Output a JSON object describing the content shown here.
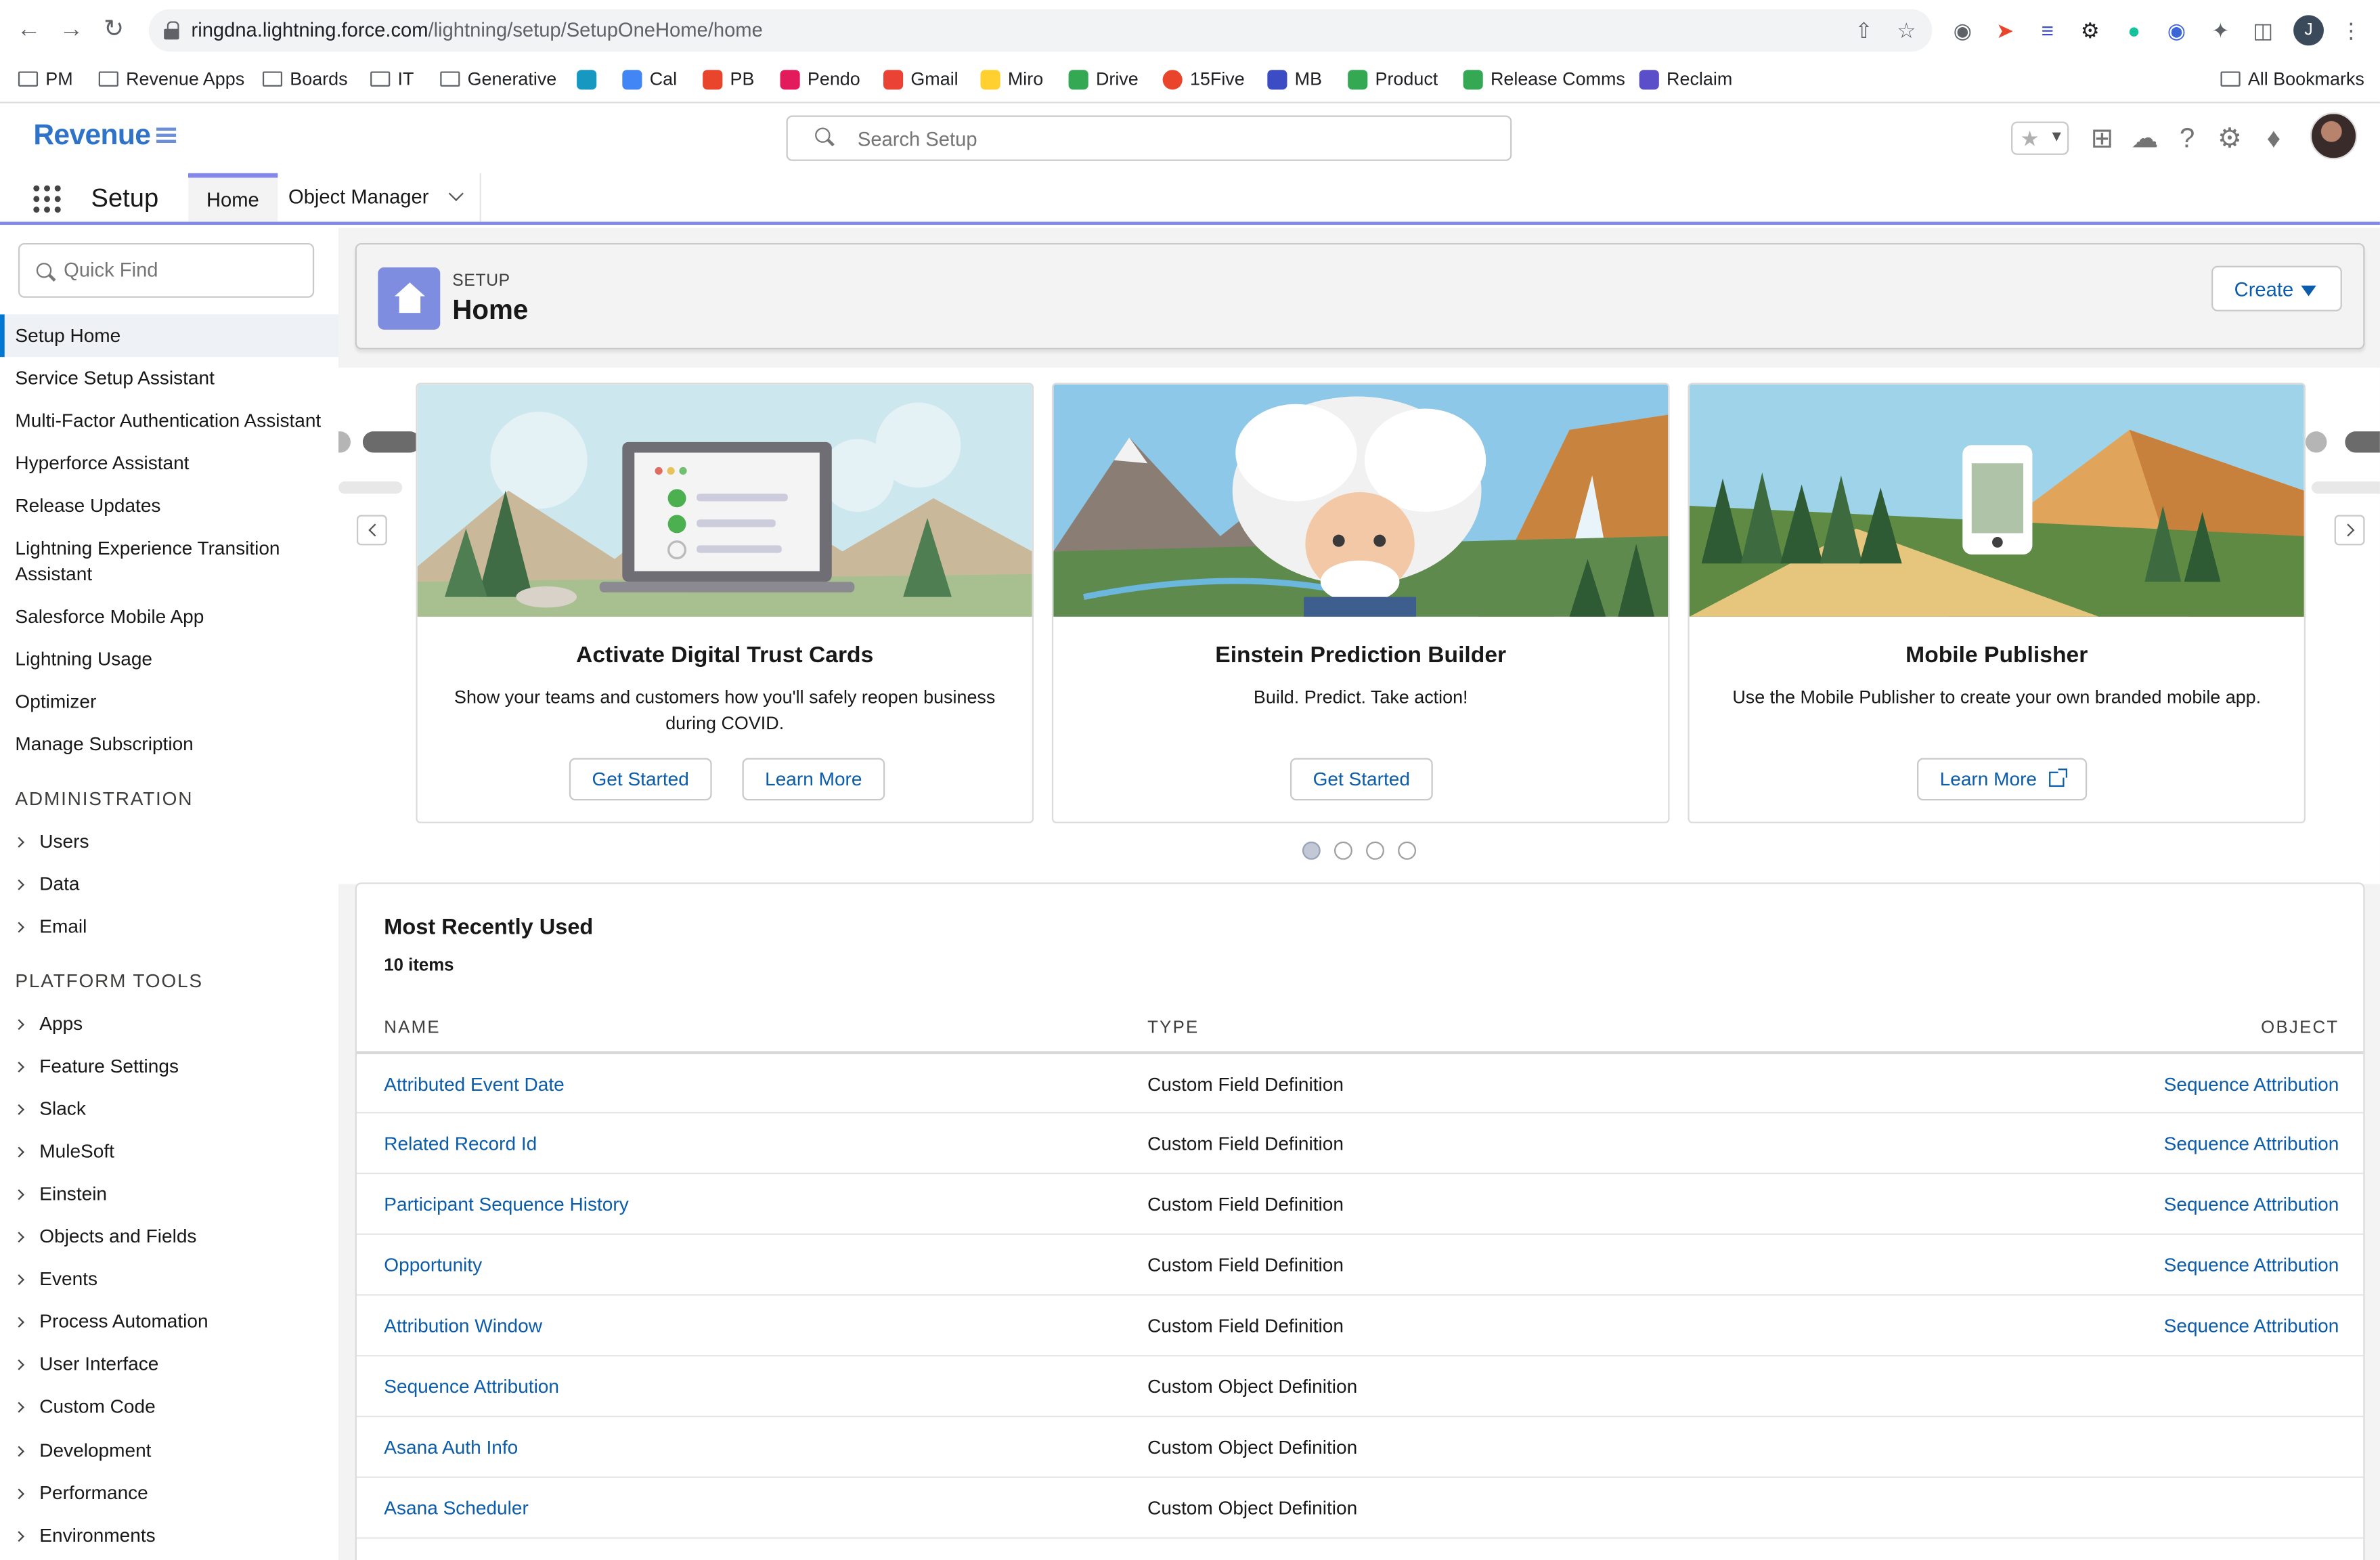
{
  "browser": {
    "url_host": "ringdna.lightning.force.com",
    "url_path": "/lightning/setup/SetupOneHome/home",
    "bookmarks": [
      "PM",
      "Revenue Apps",
      "Boards",
      "IT",
      "Generative",
      "Cal",
      "PB",
      "Pendo",
      "Gmail",
      "Miro",
      "Drive",
      "15Five",
      "MB",
      "Product",
      "Release Comms",
      "Reclaim"
    ],
    "all_bookmarks": "All Bookmarks",
    "profile_initial": "J"
  },
  "header": {
    "brand": "Revenue",
    "search_placeholder": "Search Setup"
  },
  "setup_bar": {
    "title": "Setup",
    "tabs": [
      {
        "label": "Home"
      },
      {
        "label": "Object Manager"
      }
    ]
  },
  "sidebar": {
    "quick_find_placeholder": "Quick Find",
    "items": [
      "Setup Home",
      "Service Setup Assistant",
      "Multi-Factor Authentication Assistant",
      "Hyperforce Assistant",
      "Release Updates",
      "Lightning Experience Transition Assistant",
      "Salesforce Mobile App",
      "Lightning Usage",
      "Optimizer",
      "Manage Subscription"
    ],
    "administration_heading": "ADMINISTRATION",
    "administration": [
      "Users",
      "Data",
      "Email"
    ],
    "platform_heading": "PLATFORM TOOLS",
    "platform": [
      "Apps",
      "Feature Settings",
      "Slack",
      "MuleSoft",
      "Einstein",
      "Objects and Fields",
      "Events",
      "Process Automation",
      "User Interface",
      "Custom Code",
      "Development",
      "Performance",
      "Environments"
    ]
  },
  "page_header": {
    "subtitle": "SETUP",
    "title": "Home",
    "create_label": "Create"
  },
  "carousel": {
    "cards": [
      {
        "title": "Activate Digital Trust Cards",
        "desc": "Show your teams and customers how you'll safely reopen business during COVID.",
        "btn1": "Get Started",
        "btn2": "Learn More"
      },
      {
        "title": "Einstein Prediction Builder",
        "desc": "Build. Predict. Take action!",
        "btn1": "Get Started"
      },
      {
        "title": "Mobile Publisher",
        "desc": "Use the Mobile Publisher to create your own branded mobile app.",
        "btn1": "Learn More"
      }
    ],
    "pages": 4,
    "active_page": 1
  },
  "mru": {
    "title": "Most Recently Used",
    "count": "10 items",
    "columns": {
      "name": "NAME",
      "type": "TYPE",
      "object": "OBJECT"
    },
    "rows": [
      {
        "name": "Attributed Event Date",
        "type": "Custom Field Definition",
        "object": "Sequence Attribution"
      },
      {
        "name": "Related Record Id",
        "type": "Custom Field Definition",
        "object": "Sequence Attribution"
      },
      {
        "name": "Participant Sequence History",
        "type": "Custom Field Definition",
        "object": "Sequence Attribution"
      },
      {
        "name": "Opportunity",
        "type": "Custom Field Definition",
        "object": "Sequence Attribution"
      },
      {
        "name": "Attribution Window",
        "type": "Custom Field Definition",
        "object": "Sequence Attribution"
      },
      {
        "name": "Sequence Attribution",
        "type": "Custom Object Definition",
        "object": ""
      },
      {
        "name": "Asana Auth Info",
        "type": "Custom Object Definition",
        "object": ""
      },
      {
        "name": "Asana Scheduler",
        "type": "Custom Object Definition",
        "object": ""
      }
    ]
  },
  "colors": {
    "accent": "#8287e8",
    "link": "#0b5cab",
    "brand": "#2f73c9"
  }
}
